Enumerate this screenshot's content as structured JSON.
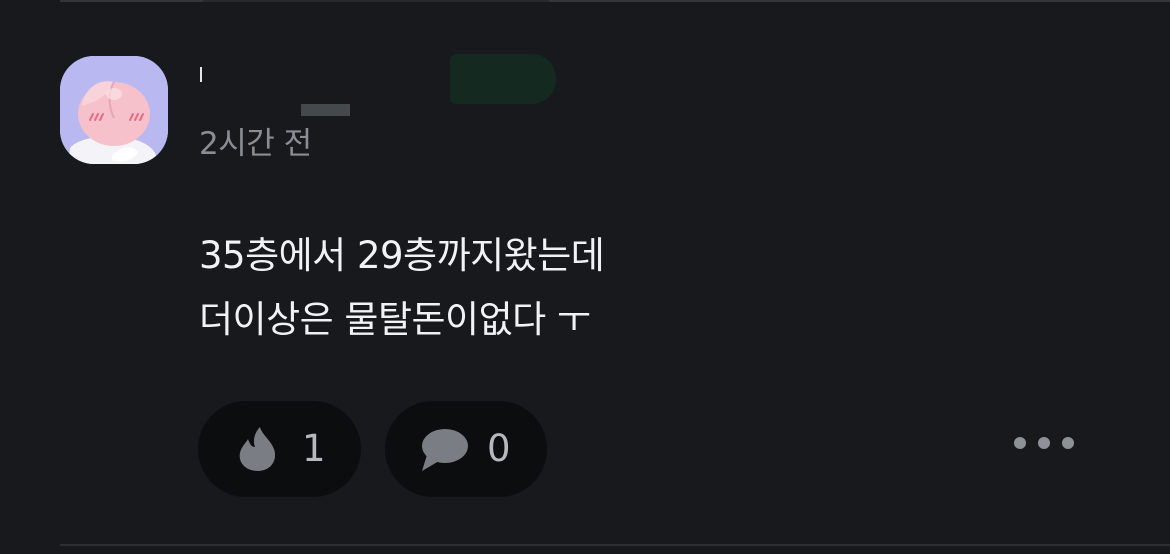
{
  "post": {
    "author_initial": "ˈ",
    "time": "2시간 전",
    "content_lines": [
      "35층에서 29층까지왔는데",
      "더이상은 물탈돈이없다 ㅜ"
    ]
  },
  "actions": {
    "like_icon": "fire-icon",
    "like_count": "1",
    "comment_icon": "speech-bubble-icon",
    "comment_count": "0",
    "more_icon": "more-dots-icon"
  },
  "colors": {
    "background": "#17191c",
    "pill": "#0c0d0f",
    "text": "#f1f2f4",
    "muted": "#8a8e94",
    "avatar_bg": "#b9b8f0"
  }
}
